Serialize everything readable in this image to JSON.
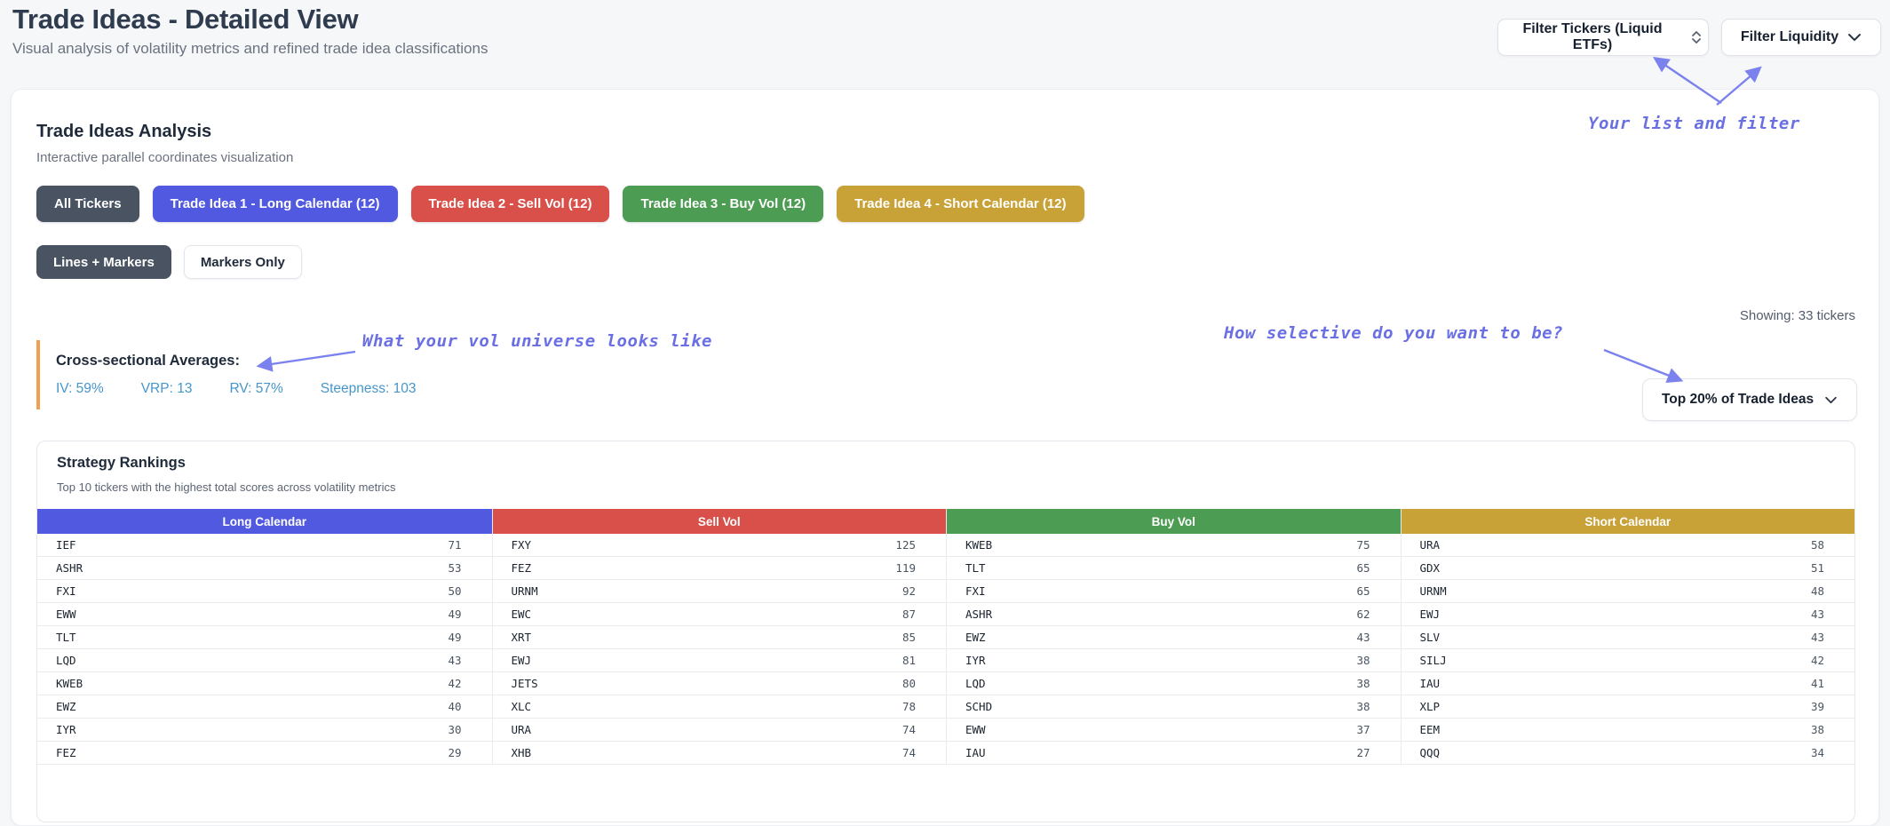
{
  "page": {
    "title": "Trade Ideas - Detailed View",
    "subtitle": "Visual analysis of volatility metrics and refined trade idea classifications"
  },
  "header_filters": {
    "tickers_label": "Filter Tickers (Liquid ETFs)",
    "liquidity_label": "Filter Liquidity"
  },
  "annotations": {
    "your_list": "Your list and filter",
    "universe": "What your vol universe looks like",
    "selective": "How selective do you want to be?"
  },
  "panel": {
    "title": "Trade Ideas Analysis",
    "subtitle": "Interactive parallel coordinates visualization",
    "showing": "Showing: 33 tickers",
    "filter_buttons": [
      {
        "name": "all-tickers-button",
        "label": "All Tickers",
        "color": "#4a5362"
      },
      {
        "name": "trade-idea-1-button",
        "label": "Trade Idea 1 - Long Calendar (12)",
        "color": "#5159e0"
      },
      {
        "name": "trade-idea-2-button",
        "label": "Trade Idea 2 - Sell Vol (12)",
        "color": "#d9504a"
      },
      {
        "name": "trade-idea-3-button",
        "label": "Trade Idea 3 - Buy Vol (12)",
        "color": "#4c9d53"
      },
      {
        "name": "trade-idea-4-button",
        "label": "Trade Idea 4 - Short Calendar (12)",
        "color": "#c8a137"
      }
    ],
    "view_toggles": [
      {
        "name": "lines-markers-toggle",
        "label": "Lines + Markers",
        "active": true
      },
      {
        "name": "markers-only-toggle",
        "label": "Markers Only",
        "active": false
      }
    ],
    "averages": {
      "heading": "Cross-sectional Averages:",
      "stats": [
        "IV: 59%",
        "VRP: 13",
        "RV: 57%",
        "Steepness: 103"
      ]
    },
    "top_select_label": "Top 20% of Trade Ideas"
  },
  "rankings": {
    "title": "Strategy Rankings",
    "subtitle": "Top 10 tickers with the highest total scores across volatility metrics",
    "columns": [
      {
        "header": "Long Calendar",
        "color": "#5159e0",
        "rows": [
          [
            "IEF",
            71
          ],
          [
            "ASHR",
            53
          ],
          [
            "FXI",
            50
          ],
          [
            "EWW",
            49
          ],
          [
            "TLT",
            49
          ],
          [
            "LQD",
            43
          ],
          [
            "KWEB",
            42
          ],
          [
            "EWZ",
            40
          ],
          [
            "IYR",
            30
          ],
          [
            "FEZ",
            29
          ]
        ]
      },
      {
        "header": "Sell Vol",
        "color": "#d9504a",
        "rows": [
          [
            "FXY",
            125
          ],
          [
            "FEZ",
            119
          ],
          [
            "URNM",
            92
          ],
          [
            "EWC",
            87
          ],
          [
            "XRT",
            85
          ],
          [
            "EWJ",
            81
          ],
          [
            "JETS",
            80
          ],
          [
            "XLC",
            78
          ],
          [
            "URA",
            74
          ],
          [
            "XHB",
            74
          ]
        ]
      },
      {
        "header": "Buy Vol",
        "color": "#4c9d53",
        "rows": [
          [
            "KWEB",
            75
          ],
          [
            "TLT",
            65
          ],
          [
            "FXI",
            65
          ],
          [
            "ASHR",
            62
          ],
          [
            "EWZ",
            43
          ],
          [
            "IYR",
            38
          ],
          [
            "LQD",
            38
          ],
          [
            "SCHD",
            38
          ],
          [
            "EWW",
            37
          ],
          [
            "IAU",
            27
          ]
        ]
      },
      {
        "header": "Short Calendar",
        "color": "#c8a137",
        "rows": [
          [
            "URA",
            58
          ],
          [
            "GDX",
            51
          ],
          [
            "URNM",
            48
          ],
          [
            "EWJ",
            43
          ],
          [
            "SLV",
            43
          ],
          [
            "SILJ",
            42
          ],
          [
            "IAU",
            41
          ],
          [
            "XLP",
            39
          ],
          [
            "EEM",
            38
          ],
          [
            "QQQ",
            34
          ]
        ]
      }
    ]
  },
  "colors": {
    "annotation": "#6a70e4",
    "arrow": "#7b82ee",
    "stat_blue": "#4696cb",
    "orange_bar": "#f0a050",
    "slate": "#4a5362"
  }
}
